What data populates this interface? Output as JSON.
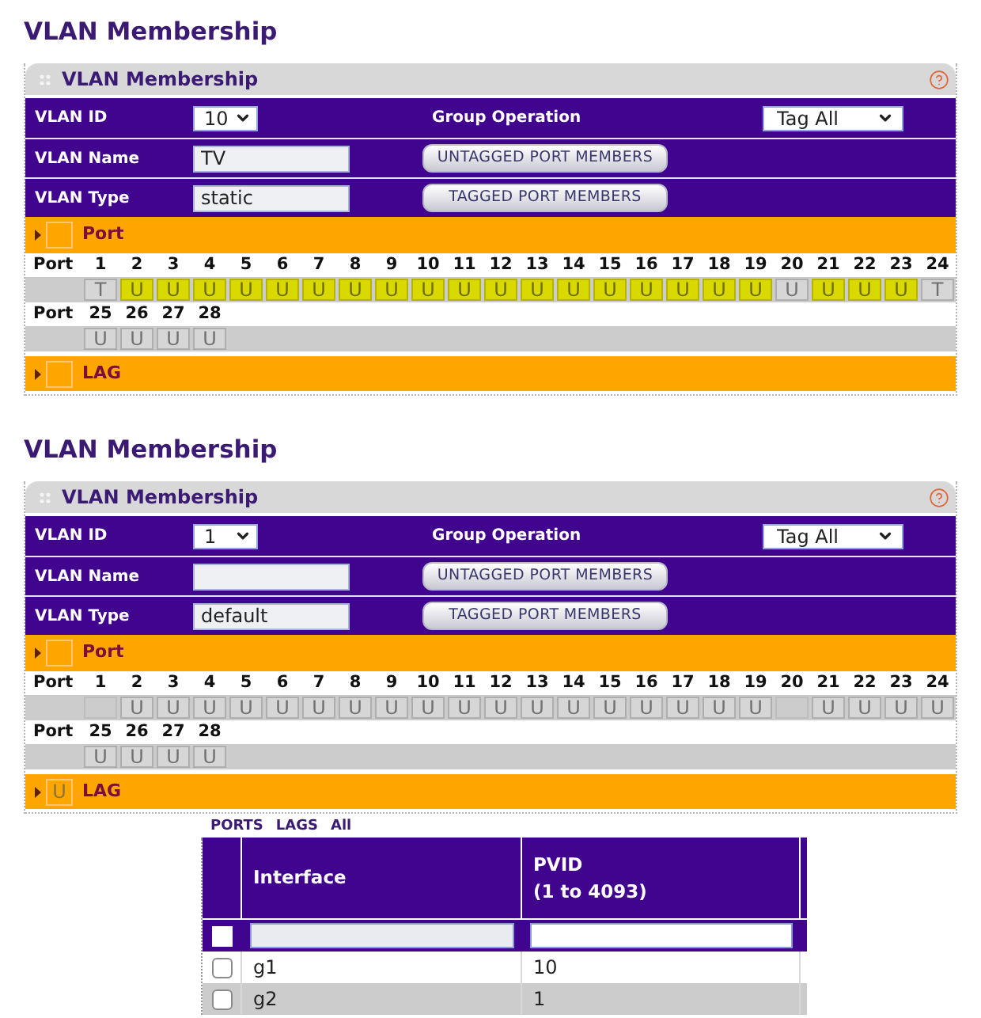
{
  "panels": [
    {
      "page_title": "VLAN Membership",
      "header": "VLAN Membership",
      "vlan_id": {
        "label": "VLAN ID",
        "value": "10"
      },
      "group_operation": {
        "label": "Group Operation",
        "value": "Tag All"
      },
      "vlan_name": {
        "label": "VLAN Name",
        "value": "TV"
      },
      "vlan_type": {
        "label": "VLAN Type",
        "value": "static"
      },
      "buttons": [
        "UNTAGGED PORT MEMBERS",
        "TAGGED PORT MEMBERS"
      ],
      "port_bar": {
        "label": "Port"
      },
      "port_rows": [
        {
          "label": "Port",
          "ports": [
            {
              "number": "1",
              "member": true,
              "membership": "T",
              "highlighted": false
            },
            {
              "number": "2",
              "member": true,
              "membership": "U",
              "highlighted": true
            },
            {
              "number": "3",
              "member": true,
              "membership": "U",
              "highlighted": true
            },
            {
              "number": "4",
              "member": true,
              "membership": "U",
              "highlighted": true
            },
            {
              "number": "5",
              "member": true,
              "membership": "U",
              "highlighted": true
            },
            {
              "number": "6",
              "member": true,
              "membership": "U",
              "highlighted": true
            },
            {
              "number": "7",
              "member": true,
              "membership": "U",
              "highlighted": true
            },
            {
              "number": "8",
              "member": true,
              "membership": "U",
              "highlighted": true
            },
            {
              "number": "9",
              "member": true,
              "membership": "U",
              "highlighted": true
            },
            {
              "number": "10",
              "member": true,
              "membership": "U",
              "highlighted": true
            },
            {
              "number": "11",
              "member": true,
              "membership": "U",
              "highlighted": true
            },
            {
              "number": "12",
              "member": true,
              "membership": "U",
              "highlighted": true
            },
            {
              "number": "13",
              "member": true,
              "membership": "U",
              "highlighted": true
            },
            {
              "number": "14",
              "member": true,
              "membership": "U",
              "highlighted": true
            },
            {
              "number": "15",
              "member": true,
              "membership": "U",
              "highlighted": true
            },
            {
              "number": "16",
              "member": true,
              "membership": "U",
              "highlighted": true
            },
            {
              "number": "17",
              "member": true,
              "membership": "U",
              "highlighted": true
            },
            {
              "number": "18",
              "member": true,
              "membership": "U",
              "highlighted": true
            },
            {
              "number": "19",
              "member": true,
              "membership": "U",
              "highlighted": true
            },
            {
              "number": "20",
              "member": true,
              "membership": "U",
              "highlighted": false
            },
            {
              "number": "21",
              "member": true,
              "membership": "U",
              "highlighted": true
            },
            {
              "number": "22",
              "member": true,
              "membership": "U",
              "highlighted": true
            },
            {
              "number": "23",
              "member": true,
              "membership": "U",
              "highlighted": true
            },
            {
              "number": "24",
              "member": true,
              "membership": "T",
              "highlighted": false
            }
          ]
        },
        {
          "label": "Port",
          "ports": [
            {
              "number": "25",
              "member": true,
              "membership": "U",
              "highlighted": false
            },
            {
              "number": "26",
              "member": true,
              "membership": "U",
              "highlighted": false
            },
            {
              "number": "27",
              "member": true,
              "membership": "U",
              "highlighted": false
            },
            {
              "number": "28",
              "member": true,
              "membership": "U",
              "highlighted": false
            }
          ]
        }
      ],
      "lag_bar": {
        "label": "LAG"
      }
    },
    {
      "page_title": "VLAN Membership",
      "header": "VLAN Membership",
      "vlan_id": {
        "label": "VLAN ID",
        "value": "1"
      },
      "group_operation": {
        "label": "Group Operation",
        "value": "Tag All"
      },
      "vlan_name": {
        "label": "VLAN Name"
      },
      "vlan_type": {
        "label": "VLAN Type",
        "value": "default"
      },
      "buttons": [
        "UNTAGGED PORT MEMBERS",
        "TAGGED PORT MEMBERS"
      ],
      "port_bar": {
        "label": "Port"
      },
      "port_rows": [
        {
          "label": "Port",
          "ports": [
            {
              "number": "1",
              "member": false
            },
            {
              "number": "2",
              "member": true,
              "membership": "U"
            },
            {
              "number": "3",
              "member": true,
              "membership": "U"
            },
            {
              "number": "4",
              "member": true,
              "membership": "U"
            },
            {
              "number": "5",
              "member": true,
              "membership": "U"
            },
            {
              "number": "6",
              "member": true,
              "membership": "U"
            },
            {
              "number": "7",
              "member": true,
              "membership": "U"
            },
            {
              "number": "8",
              "member": true,
              "membership": "U"
            },
            {
              "number": "9",
              "member": true,
              "membership": "U"
            },
            {
              "number": "10",
              "member": true,
              "membership": "U"
            },
            {
              "number": "11",
              "member": true,
              "membership": "U"
            },
            {
              "number": "12",
              "member": true,
              "membership": "U"
            },
            {
              "number": "13",
              "member": true,
              "membership": "U"
            },
            {
              "number": "14",
              "member": true,
              "membership": "U"
            },
            {
              "number": "15",
              "member": true,
              "membership": "U"
            },
            {
              "number": "16",
              "member": true,
              "membership": "U"
            },
            {
              "number": "17",
              "member": true,
              "membership": "U"
            },
            {
              "number": "18",
              "member": true,
              "membership": "U"
            },
            {
              "number": "19",
              "member": true,
              "membership": "U"
            },
            {
              "number": "20",
              "member": false
            },
            {
              "number": "21",
              "member": true,
              "membership": "U"
            },
            {
              "number": "22",
              "member": true,
              "membership": "U"
            },
            {
              "number": "23",
              "member": true,
              "membership": "U"
            },
            {
              "number": "24",
              "member": true,
              "membership": "U"
            }
          ]
        },
        {
          "label": "Port",
          "ports": [
            {
              "number": "25",
              "member": true,
              "membership": "U"
            },
            {
              "number": "26",
              "member": true,
              "membership": "U"
            },
            {
              "number": "27",
              "member": true,
              "membership": "U"
            },
            {
              "number": "28",
              "member": true,
              "membership": "U"
            }
          ]
        }
      ],
      "lag_bar": {
        "label": "LAG",
        "membership": "U"
      }
    }
  ],
  "port_table": {
    "filter_tabs": [
      "PORTS",
      "LAGS",
      "All"
    ],
    "columns": [
      {
        "label": "Interface"
      },
      {
        "label": "PVID",
        "sublabel": "(1 to 4093)"
      }
    ],
    "filter_row": {
      "checked": false
    },
    "rows": [
      {
        "interface": "g1",
        "pvid": "10",
        "checked": false
      },
      {
        "interface": "g2",
        "pvid": "1",
        "checked": false
      }
    ]
  }
}
